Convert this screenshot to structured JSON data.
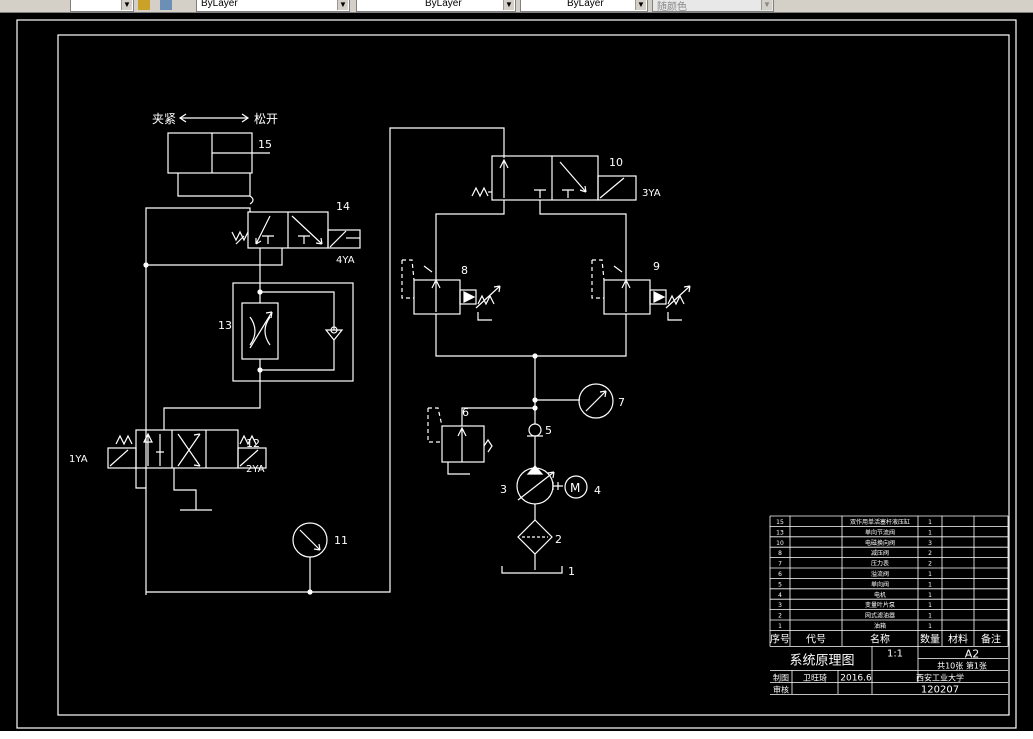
{
  "toolbar": {
    "layer_color_label": "ByLayer",
    "linetype_label": "ByLayer",
    "lineweight_label": "ByLayer",
    "plotstyle_label": "随颜色"
  },
  "diagram": {
    "clamp_label": "夹紧",
    "release_label": "松开",
    "labels": {
      "c15": "15",
      "c14": "14",
      "y4": "4YA",
      "c13": "13",
      "c12": "12",
      "y1": "1YA",
      "y2": "2YA",
      "c11": "11",
      "c10": "10",
      "y3": "3YA",
      "c9": "9",
      "c8": "8",
      "c7": "7",
      "c6": "6",
      "c5": "5",
      "c4": "4",
      "c3": "3",
      "c2": "2",
      "c1": "1",
      "motor": "M"
    }
  },
  "title_block": {
    "parts": [
      {
        "no": "15",
        "name": "双作用单活塞杆液压缸",
        "qty": "1"
      },
      {
        "no": "13",
        "name": "单向节流阀",
        "qty": "1"
      },
      {
        "no": "10",
        "name": "电磁换向阀",
        "qty": "3"
      },
      {
        "no": "8",
        "name": "减压阀",
        "qty": "2"
      },
      {
        "no": "7",
        "name": "压力表",
        "qty": "2"
      },
      {
        "no": "6",
        "name": "溢流阀",
        "qty": "1"
      },
      {
        "no": "5",
        "name": "单向阀",
        "qty": "1"
      },
      {
        "no": "4",
        "name": "电机",
        "qty": "1"
      },
      {
        "no": "3",
        "name": "变量叶片泵",
        "qty": "1"
      },
      {
        "no": "2",
        "name": "网式滤油器",
        "qty": "1"
      },
      {
        "no": "1",
        "name": "油箱",
        "qty": "1"
      }
    ],
    "header": {
      "no": "序号",
      "code": "代号",
      "name": "名称",
      "qty": "数量",
      "material": "材料",
      "remark": "备注"
    },
    "drawing_title": "系统原理图",
    "scale": "1:1",
    "size": "A2",
    "sheets": "共10张 第1张",
    "drawn_label": "制图",
    "drawn_by": "卫旺琦",
    "date": "2016.6",
    "school": "西安工业大学",
    "check_label": "审核",
    "number": "120207"
  }
}
